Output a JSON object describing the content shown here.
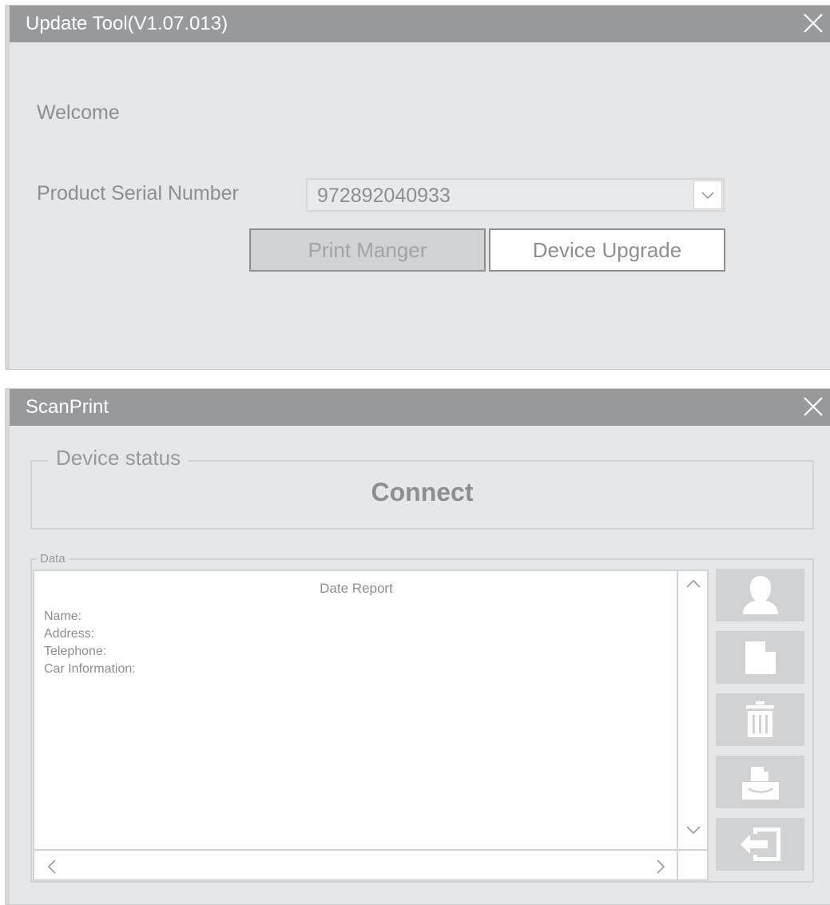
{
  "update_tool": {
    "title": "Update Tool(V1.07.013)",
    "welcome": "Welcome",
    "serial_label": "Product Serial Number",
    "serial_value": "972892040933",
    "print_button": "Print Manger",
    "upgrade_button": "Device Upgrade"
  },
  "scanprint": {
    "title": "ScanPrint",
    "status_legend": "Device status",
    "status_value": "Connect",
    "data_legend": "Data",
    "report": {
      "title": "Date Report",
      "lines": [
        "Name:",
        "Address:",
        "Telephone:",
        "Car Information:"
      ]
    },
    "side_buttons": [
      "user-icon",
      "document-icon",
      "trash-icon",
      "print-icon",
      "exit-icon"
    ]
  },
  "colors": {
    "titlebar": "#98999b",
    "window_bg": "#e6e7e9",
    "button_bg": "#d1d2d4",
    "text": "#8d8e90"
  }
}
